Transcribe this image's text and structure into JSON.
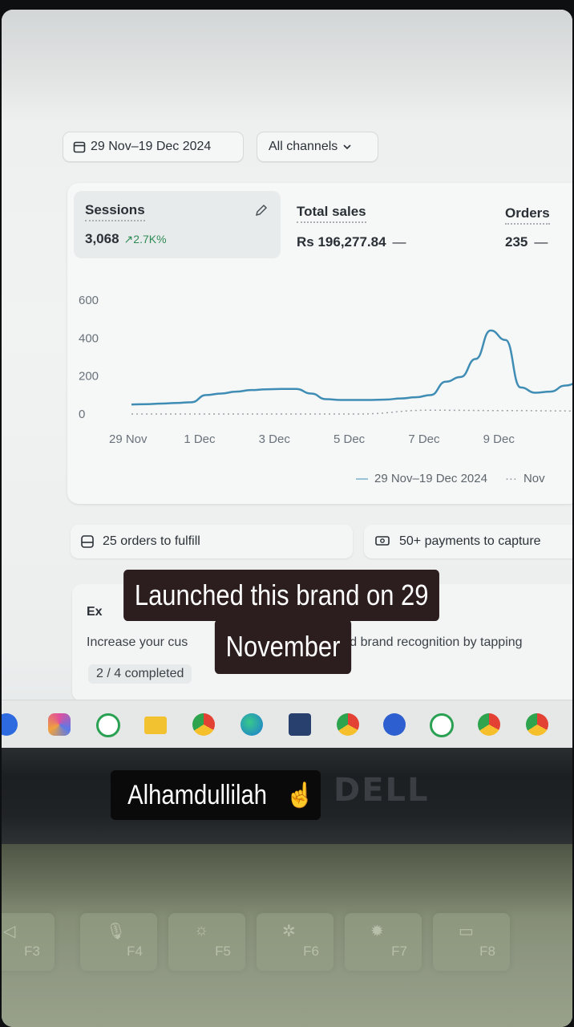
{
  "filters": {
    "date_range": "29 Nov–19 Dec 2024",
    "channel": "All channels"
  },
  "metrics": {
    "sessions": {
      "label": "Sessions",
      "value": "3,068",
      "change": "↗2.7K%"
    },
    "total_sales": {
      "label": "Total sales",
      "value": "Rs 196,277.84",
      "change": "—"
    },
    "orders": {
      "label": "Orders",
      "value": "235",
      "change": "—"
    }
  },
  "chart_data": {
    "type": "line",
    "title": "",
    "xlabel": "",
    "ylabel": "",
    "ylim": [
      0,
      600
    ],
    "y_ticks": [
      "600",
      "400",
      "200",
      "0"
    ],
    "categories": [
      "29 Nov",
      "1 Dec",
      "3 Dec",
      "5 Dec",
      "7 Dec",
      "9 Dec"
    ],
    "series": [
      {
        "name": "29 Nov–19 Dec 2024",
        "color": "#3f8db5",
        "style": "solid",
        "x": [
          0,
          0.4,
          0.8,
          1.2,
          1.6,
          2.0,
          2.4,
          2.8,
          3.2,
          3.6,
          4.0,
          4.4,
          4.8,
          5.2,
          5.6,
          6.0,
          6.4,
          6.8,
          7.2,
          7.6,
          8.0,
          8.4,
          8.8,
          9.2,
          9.6,
          10.0,
          10.4,
          10.8,
          11.2,
          11.6,
          12.0
        ],
        "values": [
          50,
          52,
          55,
          58,
          62,
          100,
          108,
          118,
          126,
          130,
          132,
          132,
          108,
          78,
          74,
          74,
          74,
          76,
          82,
          88,
          100,
          170,
          195,
          290,
          440,
          390,
          140,
          112,
          118,
          150,
          170
        ]
      },
      {
        "name": "Nov",
        "color": "#9aa1a6",
        "style": "dotted",
        "x": [
          0,
          2,
          4,
          6,
          8,
          10,
          12
        ],
        "values": [
          0,
          0,
          0,
          0,
          20,
          18,
          16
        ]
      }
    ],
    "legend": [
      "29 Nov–19 Dec 2024",
      "Nov"
    ],
    "legend_position": "bottom",
    "grid": true
  },
  "tasks": {
    "fulfill": "25 orders to fulfill",
    "payments": "50+ payments to capture"
  },
  "setup_guide": {
    "title": "Ex",
    "description_left": "Increase your cus",
    "description_right": "d brand recognition by tapping",
    "progress": "2 / 4 completed"
  },
  "overlay": {
    "caption_line1": "Launched this brand on 29",
    "caption_line2": "November",
    "sticker_text": "Alhamdullilah",
    "sticker_emoji": "☝️"
  },
  "hardware": {
    "brand": "DELL",
    "keys": [
      "F3",
      "F4",
      "F5",
      "F6",
      "F7",
      "F8"
    ]
  },
  "taskbar_icons": [
    "zoom-icon",
    "copilot-icon",
    "whatsapp-icon",
    "file-explorer-icon",
    "chrome-icon",
    "edge-icon",
    "store-icon",
    "chrome-profile-icon",
    "vpn-icon",
    "whatsapp-business-icon",
    "chrome-icon",
    "chrome-icon"
  ],
  "colors": {
    "accent": "#3f8db5",
    "positive": "#2f8c55",
    "caption_bg": "#2c1e1e"
  }
}
